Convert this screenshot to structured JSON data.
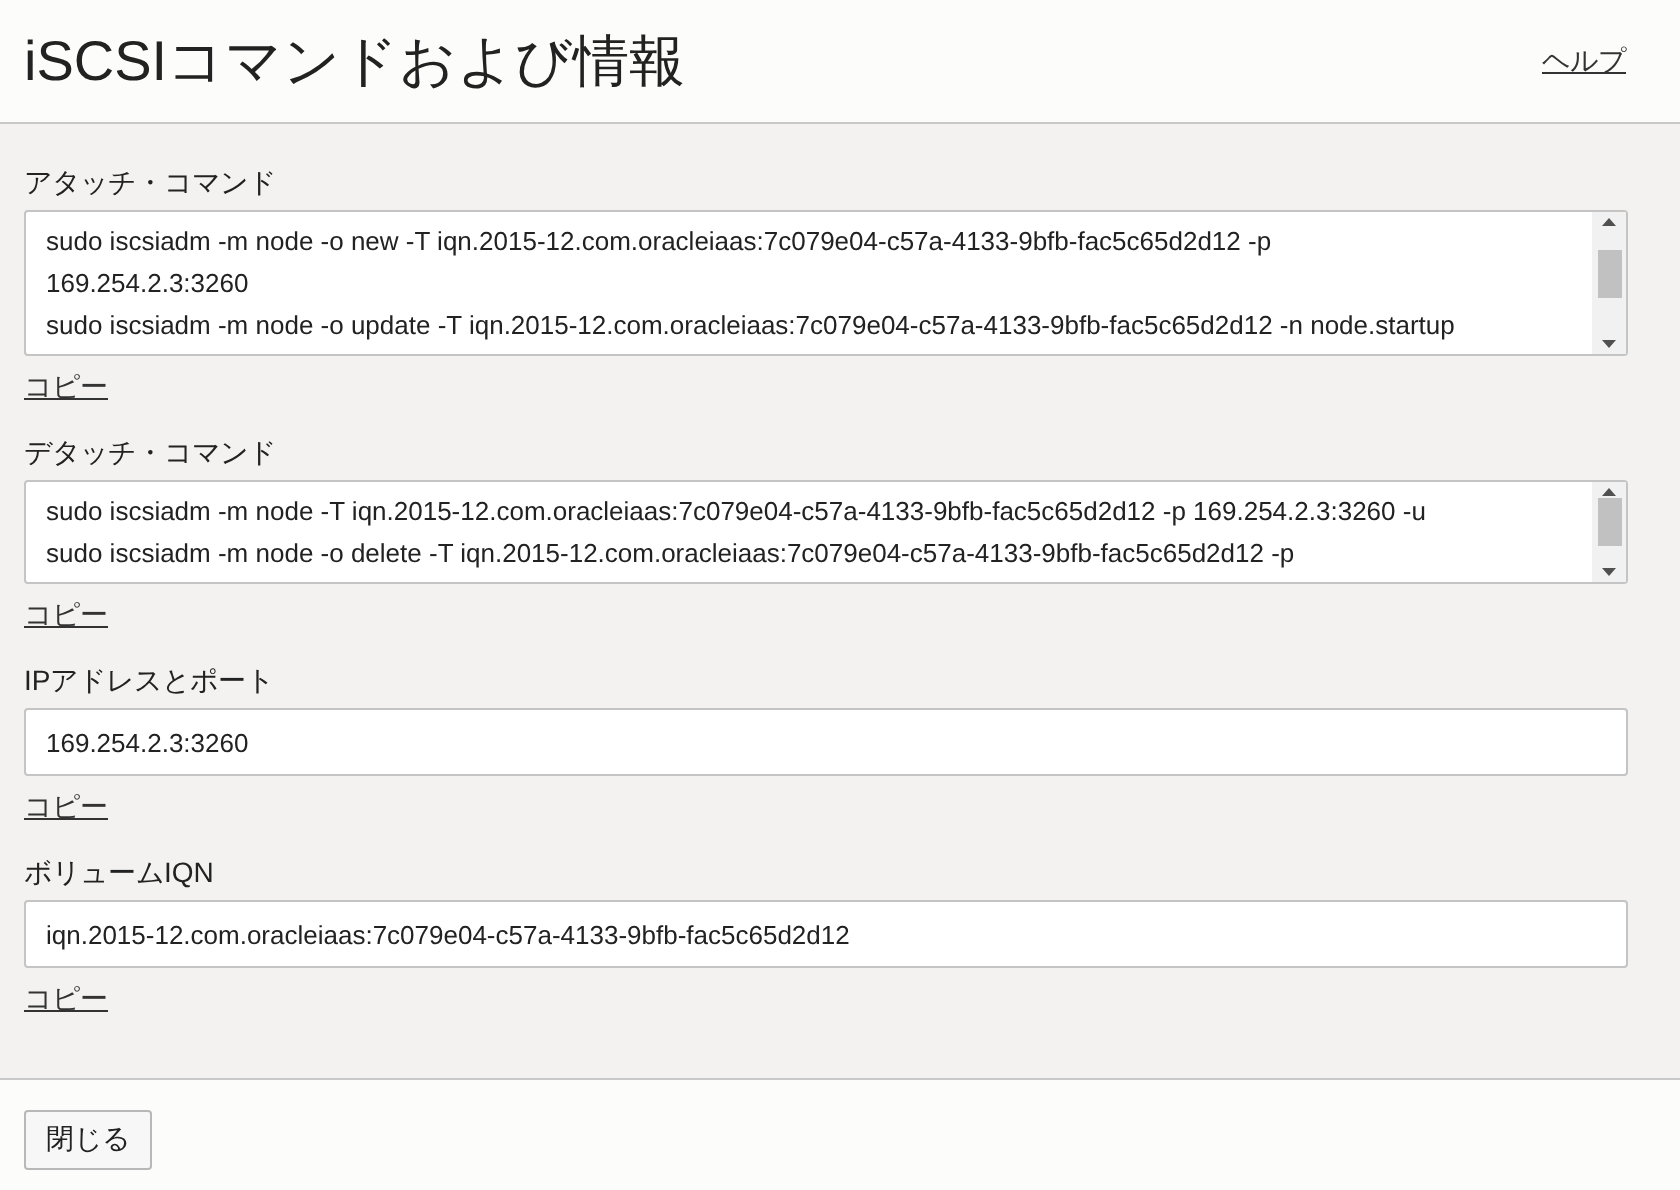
{
  "header": {
    "title": "iSCSIコマンドおよび情報",
    "help_link": "ヘルプ"
  },
  "sections": [
    {
      "kind": "textarea",
      "label": "アタッチ・コマンド",
      "lines": [
        "sudo iscsiadm -m node -o new -T iqn.2015-12.com.oracleiaas:7c079e04-c57a-4133-9bfb-fac5c65d2d12 -p",
        "169.254.2.3:3260",
        "sudo iscsiadm -m node -o update -T iqn.2015-12.com.oracleiaas:7c079e04-c57a-4133-9bfb-fac5c65d2d12 -n node.startup"
      ],
      "copy_link": "コピー"
    },
    {
      "kind": "textarea",
      "label": "デタッチ・コマンド",
      "lines": [
        "sudo iscsiadm -m node -T iqn.2015-12.com.oracleiaas:7c079e04-c57a-4133-9bfb-fac5c65d2d12 -p 169.254.2.3:3260 -u",
        "sudo iscsiadm -m node -o delete -T iqn.2015-12.com.oracleiaas:7c079e04-c57a-4133-9bfb-fac5c65d2d12 -p"
      ],
      "copy_link": "コピー"
    },
    {
      "kind": "field",
      "label": "IPアドレスとポート",
      "value": "169.254.2.3:3260",
      "copy_link": "コピー"
    },
    {
      "kind": "field",
      "label": "ボリュームIQN",
      "value": "iqn.2015-12.com.oracleiaas:7c079e04-c57a-4133-9bfb-fac5c65d2d12",
      "copy_link": "コピー"
    }
  ],
  "footer": {
    "close_button": "閉じる"
  }
}
